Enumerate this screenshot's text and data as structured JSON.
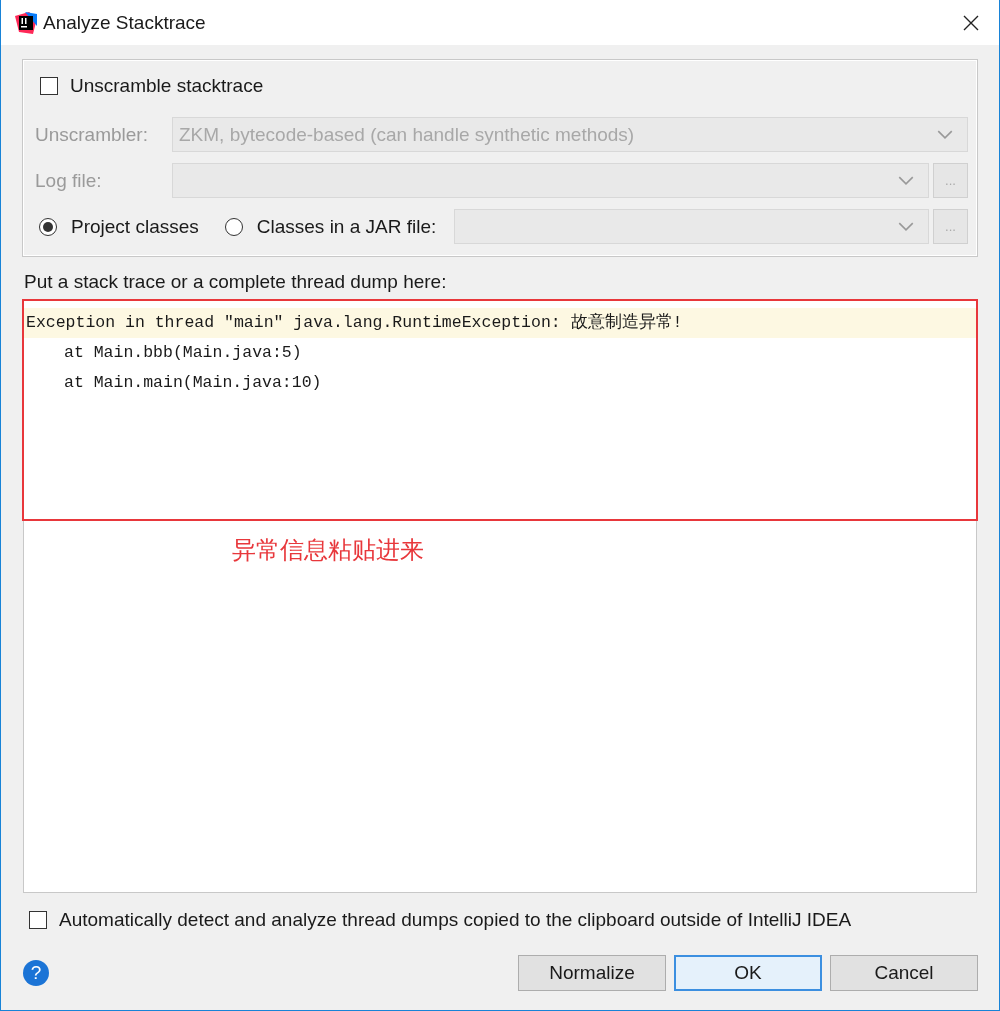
{
  "window": {
    "title": "Analyze Stacktrace"
  },
  "unscramble": {
    "label": "Unscramble stacktrace",
    "checked": false
  },
  "unscrambler": {
    "label": "Unscrambler:",
    "value": "ZKM, bytecode-based (can handle synthetic methods)",
    "disabled": true
  },
  "log_file": {
    "label": "Log file:",
    "disabled": true,
    "browse": "..."
  },
  "sources": [
    {
      "label": "Project classes",
      "selected": true
    },
    {
      "label": "Classes in a JAR file:",
      "selected": false
    }
  ],
  "jar_field": {
    "disabled": true,
    "browse": "..."
  },
  "stack_trace": {
    "label": "Put a stack trace or a complete thread dump here:",
    "lines": [
      {
        "text": "Exception in thread \"main\" java.lang.RuntimeException: 故意制造异常!",
        "current": true,
        "indented": false
      },
      {
        "text": "at Main.bbb(Main.java:5)",
        "current": false,
        "indented": true
      },
      {
        "text": "at Main.main(Main.java:10)",
        "current": false,
        "indented": true
      }
    ]
  },
  "annotation": {
    "text": "异常信息粘贴进来"
  },
  "auto_detect": {
    "label": "Automatically detect and analyze thread dumps copied to the clipboard outside of IntelliJ IDEA",
    "checked": false
  },
  "help": {
    "icon": "?"
  },
  "buttons": [
    {
      "label": "Normalize",
      "default": false
    },
    {
      "label": "OK",
      "default": true
    },
    {
      "label": "Cancel",
      "default": false
    }
  ]
}
